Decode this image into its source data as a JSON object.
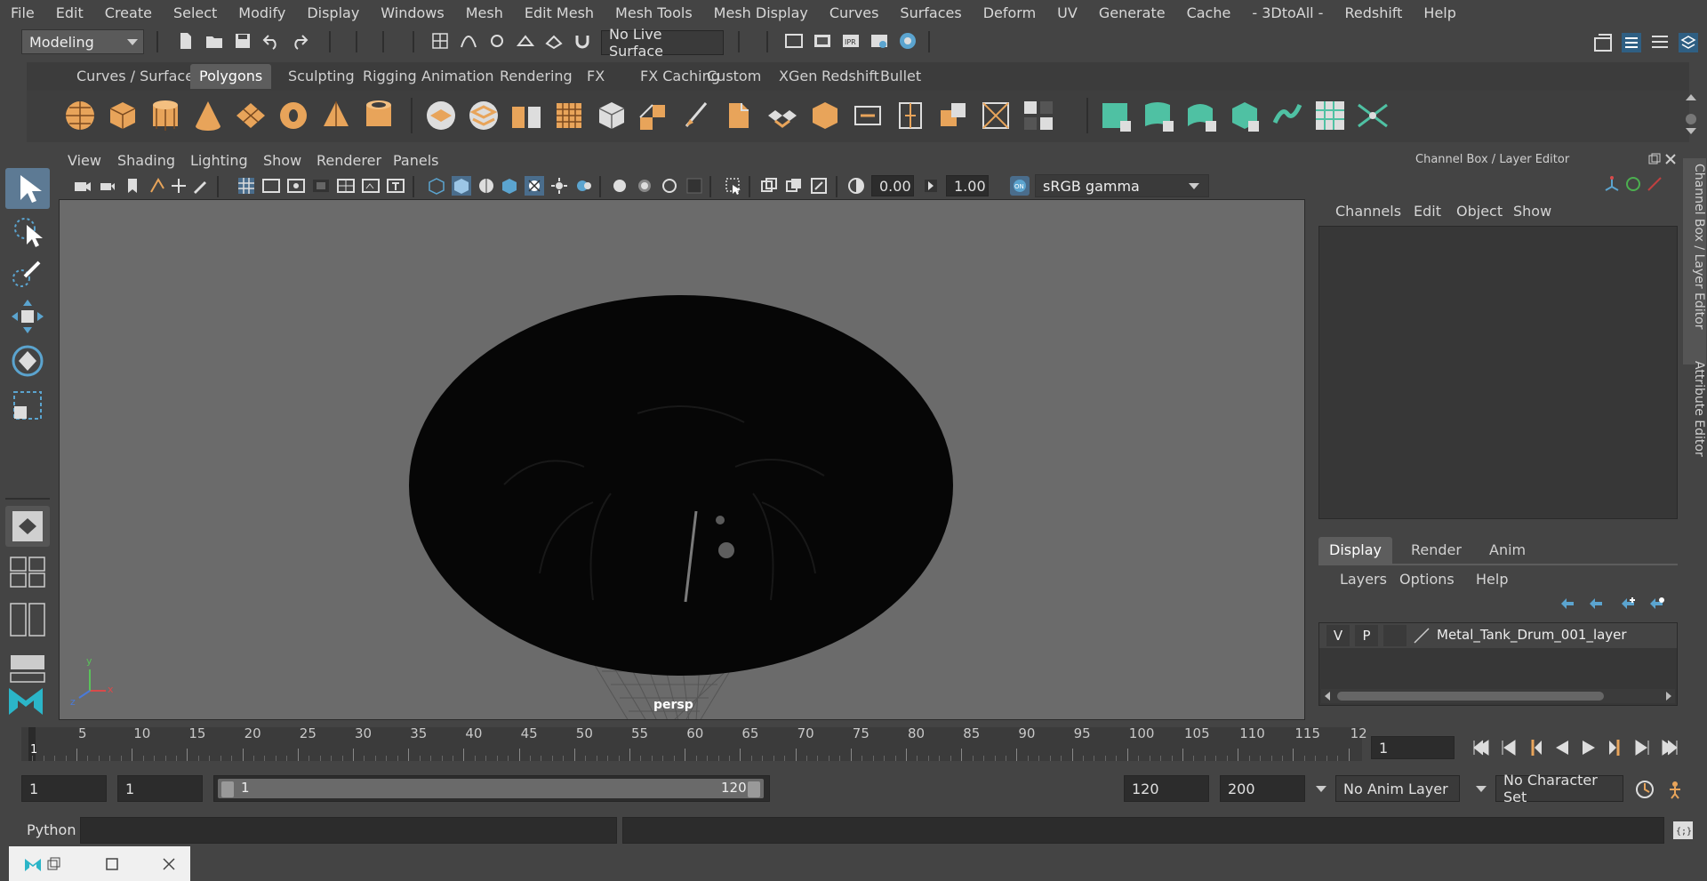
{
  "menubar": [
    "File",
    "Edit",
    "Create",
    "Select",
    "Modify",
    "Display",
    "Windows",
    "Mesh",
    "Edit Mesh",
    "Mesh Tools",
    "Mesh Display",
    "Curves",
    "Surfaces",
    "Deform",
    "UV",
    "Generate",
    "Cache",
    "- 3DtoAll -",
    "Redshift",
    "Help"
  ],
  "status": {
    "mode": "Modeling",
    "live_surface": "No Live Surface"
  },
  "shelf_tabs": [
    "Curves / Surfaces",
    "Polygons",
    "Sculpting",
    "Rigging",
    "Animation",
    "Rendering",
    "FX",
    "FX Caching",
    "Custom",
    "XGen",
    "Redshift",
    "Bullet"
  ],
  "shelf_active": "Polygons",
  "viewport": {
    "menus": [
      "View",
      "Shading",
      "Lighting",
      "Show",
      "Renderer",
      "Panels"
    ],
    "exposure": "0.00",
    "gamma": "1.00",
    "color_space": "sRGB gamma",
    "camera_label": "persp",
    "axis_x": "x",
    "axis_y": "y",
    "axis_z": "z"
  },
  "channel_box": {
    "title": "Channel Box / Layer Editor",
    "menus": [
      "Channels",
      "Edit",
      "Object",
      "Show"
    ]
  },
  "layer_editor": {
    "tabs": [
      "Display",
      "Render",
      "Anim"
    ],
    "active_tab": "Display",
    "menus": [
      "Layers",
      "Options",
      "Help"
    ],
    "layer": {
      "v": "V",
      "p": "P",
      "name": "Metal_Tank_Drum_001_layer"
    }
  },
  "side_tabs": [
    "Channel Box / Layer Editor",
    "Attribute Editor"
  ],
  "timeline": {
    "ticks": [
      "5",
      "10",
      "15",
      "20",
      "25",
      "30",
      "35",
      "40",
      "45",
      "50",
      "55",
      "60",
      "65",
      "70",
      "75",
      "80",
      "85",
      "90",
      "95",
      "100",
      "105",
      "110",
      "115",
      "12"
    ],
    "start_marker": "1",
    "current_frame": "1"
  },
  "range": {
    "start": "1",
    "anim_start": "1",
    "slider_start": "1",
    "slider_end": "120",
    "anim_end": "120",
    "end": "200",
    "anim_layer": "No Anim Layer",
    "character_set": "No Character Set"
  },
  "command": {
    "label": "Python"
  },
  "colors": {
    "accent": "#5ba4cf",
    "shelf_orange": "#e8a45a",
    "shelf_teal": "#4fc1a3"
  }
}
